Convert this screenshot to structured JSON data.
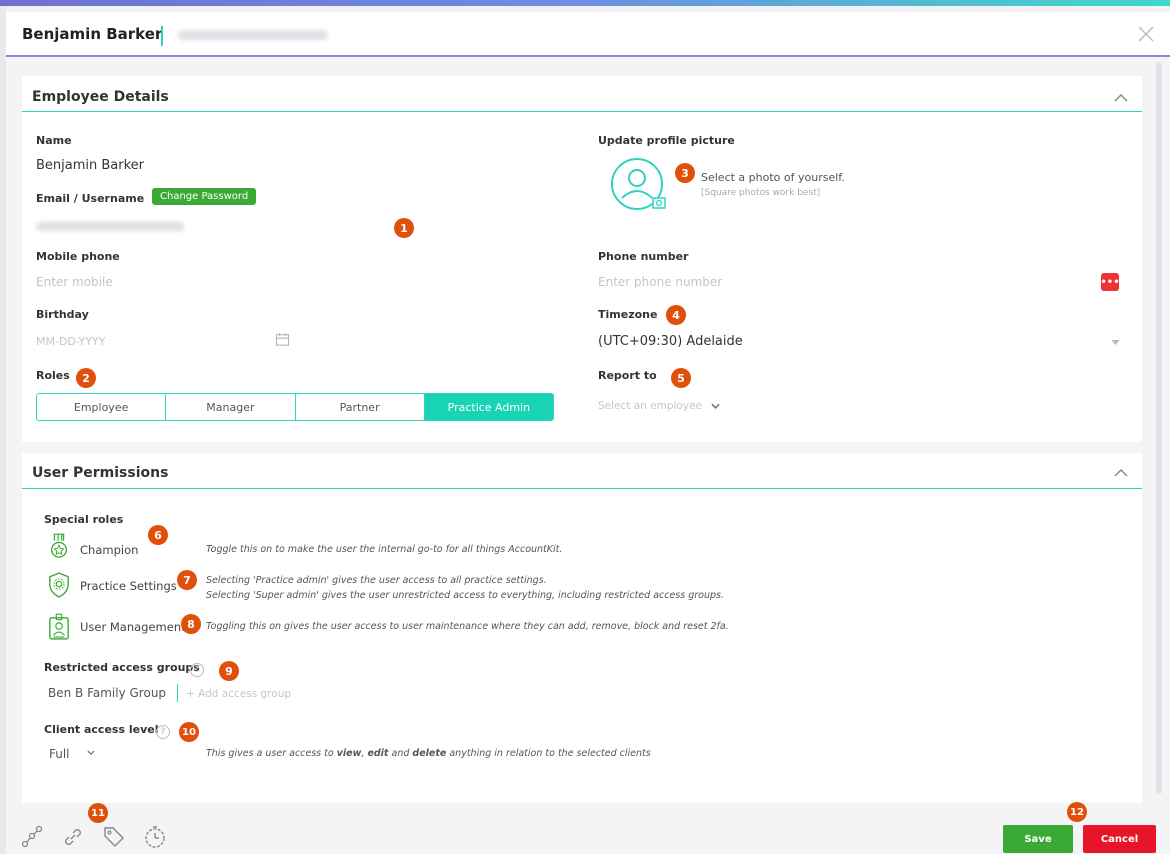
{
  "header": {
    "name": "Benjamin Barker"
  },
  "employee_details": {
    "title": "Employee Details",
    "name_label": "Name",
    "name_value": "Benjamin Barker",
    "email_label": "Email / Username",
    "change_password": "Change Password",
    "mobile_label": "Mobile phone",
    "mobile_placeholder": "Enter mobile",
    "birthday_label": "Birthday",
    "birthday_placeholder": "MM-DD-YYYY",
    "roles_label": "Roles",
    "roles": [
      "Employee",
      "Manager",
      "Partner",
      "Practice Admin"
    ],
    "roles_selected": "Practice Admin",
    "profile_label": "Update profile picture",
    "profile_hint": "Select a photo of yourself.",
    "profile_subhint": "[Square photos work best]",
    "phone_label": "Phone number",
    "phone_placeholder": "Enter phone number",
    "timezone_label": "Timezone",
    "timezone_value": "(UTC+09:30) Adelaide",
    "report_label": "Report to",
    "report_placeholder": "Select an employee"
  },
  "permissions": {
    "title": "User Permissions",
    "special_roles_label": "Special roles",
    "champion": "Champion",
    "champion_desc": "Toggle this on to make the user the internal go-to for all things AccountKit.",
    "practice_settings": "Practice Settings",
    "practice_desc_1": "Selecting 'Practice admin' gives the user access to all practice settings.",
    "practice_desc_2": "Selecting 'Super admin' gives the user unrestricted access to everything, including restricted access groups.",
    "user_mgmt": "User Management",
    "user_mgmt_desc": "Toggling this on gives the user access to user maintenance where they can add, remove, block and reset 2fa.",
    "restricted_label": "Restricted access groups",
    "group_name": "Ben B Family Group",
    "add_group": "+ Add access group",
    "client_label": "Client  access level",
    "client_value": "Full",
    "client_desc_1": "This gives a user access to ",
    "client_desc_view": "view",
    "client_desc_2": ", ",
    "client_desc_edit": "edit",
    "client_desc_3": " and ",
    "client_desc_delete": "delete",
    "client_desc_4": " anything in relation to the selected clients"
  },
  "badges": [
    "1",
    "2",
    "3",
    "4",
    "5",
    "6",
    "7",
    "8",
    "9",
    "10",
    "11",
    "12"
  ],
  "footer": {
    "save": "Save",
    "cancel": "Cancel"
  },
  "colors": {
    "teal": "#2dd4bf",
    "green": "#3aaa35",
    "red": "#e8142a",
    "badge": "#e0500b"
  }
}
